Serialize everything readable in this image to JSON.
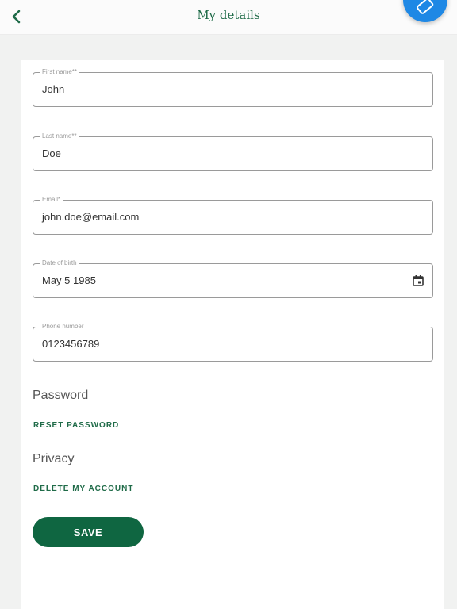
{
  "header": {
    "title": "My details",
    "back_icon": "chevron-left-icon",
    "fab_icon": "rotate-phone-icon",
    "accent_color": "#1f6b48",
    "fab_color": "#1e88e5"
  },
  "form": {
    "first_name": {
      "label": "First name**",
      "value": "John"
    },
    "last_name": {
      "label": "Last name**",
      "value": "Doe"
    },
    "email": {
      "label": "Email*",
      "value": "john.doe@email.com"
    },
    "date_of_birth": {
      "label": "Date of birth",
      "value": "May 5 1985",
      "icon": "calendar-icon"
    },
    "phone": {
      "label": "Phone number",
      "value": "0123456789"
    }
  },
  "password": {
    "title": "Password",
    "reset_label": "RESET PASSWORD"
  },
  "privacy": {
    "title": "Privacy",
    "delete_label": "DELETE MY ACCOUNT"
  },
  "save": {
    "label": "SAVE",
    "color": "#0f6641"
  }
}
